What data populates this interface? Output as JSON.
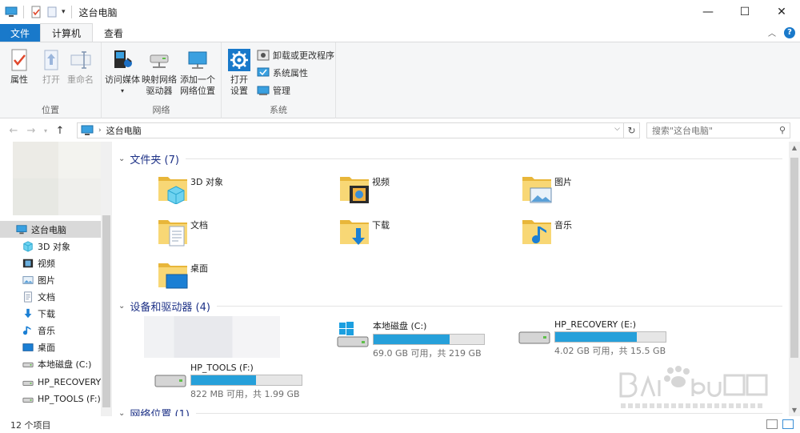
{
  "window": {
    "title": "这台电脑"
  },
  "tabs": [
    {
      "label": "文件"
    },
    {
      "label": "计算机"
    },
    {
      "label": "查看"
    }
  ],
  "ribbon": {
    "groups": {
      "location": {
        "label": "位置",
        "buttons": [
          "属性",
          "打开",
          "重命名"
        ]
      },
      "network": {
        "label": "网络",
        "buttons": [
          {
            "line1": "访问媒体",
            "line2": ""
          },
          {
            "line1": "映射网络",
            "line2": "驱动器"
          },
          {
            "line1": "添加一个",
            "line2": "网络位置"
          }
        ]
      },
      "system": {
        "label": "系统",
        "open_settings": {
          "line1": "打开",
          "line2": "设置"
        },
        "small_buttons": [
          "卸载或更改程序",
          "系统属性",
          "管理"
        ]
      }
    }
  },
  "address": {
    "path": "这台电脑",
    "search_placeholder": "搜索\"这台电脑\""
  },
  "nav_pane": {
    "items": [
      {
        "label": "这台电脑",
        "icon": "computer-icon",
        "selected": true
      },
      {
        "label": "3D 对象",
        "icon": "3d-objects-icon"
      },
      {
        "label": "视频",
        "icon": "video-icon"
      },
      {
        "label": "图片",
        "icon": "pictures-icon"
      },
      {
        "label": "文档",
        "icon": "documents-icon"
      },
      {
        "label": "下载",
        "icon": "download-icon"
      },
      {
        "label": "音乐",
        "icon": "music-icon"
      },
      {
        "label": "桌面",
        "icon": "desktop-icon"
      },
      {
        "label": "本地磁盘 (C:)",
        "icon": "drive-icon"
      },
      {
        "label": "HP_RECOVERY",
        "icon": "drive-icon"
      },
      {
        "label": "HP_TOOLS (F:)",
        "icon": "drive-icon"
      }
    ]
  },
  "content": {
    "folders_header": "文件夹 (7)",
    "folders": [
      {
        "label": "3D 对象",
        "icon": "3d-objects-icon"
      },
      {
        "label": "视频",
        "icon": "video-icon"
      },
      {
        "label": "图片",
        "icon": "pictures-icon"
      },
      {
        "label": "文档",
        "icon": "documents-icon"
      },
      {
        "label": "下载",
        "icon": "download-icon"
      },
      {
        "label": "音乐",
        "icon": "music-icon"
      },
      {
        "label": "桌面",
        "icon": "desktop-icon"
      }
    ],
    "drives_header": "设备和驱动器 (4)",
    "drives": [
      {
        "name": "本地磁盘 (C:)",
        "usage": "69.0 GB 可用，共 219 GB",
        "used_fraction": 0.685,
        "icon": "windows-drive-icon"
      },
      {
        "name": "HP_RECOVERY (E:)",
        "usage": "4.02 GB 可用，共 15.5 GB",
        "used_fraction": 0.74,
        "icon": "drive-icon"
      },
      {
        "name": "HP_TOOLS (F:)",
        "usage": "822 MB 可用，共 1.99 GB",
        "used_fraction": 0.59,
        "icon": "drive-icon"
      }
    ],
    "network_header": "网络位置 (1)"
  },
  "status": {
    "count": "12 个项目"
  },
  "colors": {
    "accent": "#1979ca",
    "bar_fill": "#26a0da",
    "section_header": "#1e3287"
  }
}
